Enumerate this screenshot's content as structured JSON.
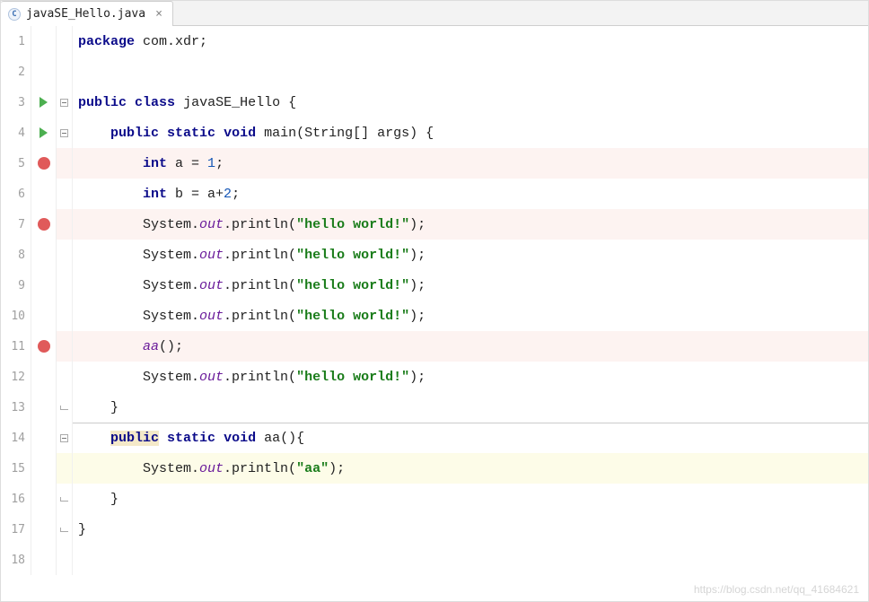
{
  "tab": {
    "filename": "javaSE_Hello.java",
    "close_glyph": "×",
    "icon_letter": "C"
  },
  "lines": [
    {
      "n": 1,
      "icon": "",
      "fold": "",
      "bp": false,
      "hl": false,
      "sep": false,
      "code": [
        {
          "cls": "kw",
          "t": "package"
        },
        {
          "cls": "pln",
          "t": " "
        },
        {
          "cls": "pkg",
          "t": "com.xdr"
        },
        {
          "cls": "pln",
          "t": ";"
        }
      ]
    },
    {
      "n": 2,
      "icon": "",
      "fold": "",
      "bp": false,
      "hl": false,
      "sep": false,
      "code": [
        {
          "cls": "pln",
          "t": ""
        }
      ]
    },
    {
      "n": 3,
      "icon": "run",
      "fold": "open",
      "bp": false,
      "hl": false,
      "sep": false,
      "code": [
        {
          "cls": "kw",
          "t": "public"
        },
        {
          "cls": "pln",
          "t": " "
        },
        {
          "cls": "kw",
          "t": "class"
        },
        {
          "cls": "pln",
          "t": " "
        },
        {
          "cls": "id",
          "t": "javaSE_Hello"
        },
        {
          "cls": "pln",
          "t": " {"
        }
      ]
    },
    {
      "n": 4,
      "icon": "run",
      "fold": "open",
      "bp": false,
      "hl": false,
      "sep": false,
      "code": [
        {
          "cls": "pln",
          "t": "    "
        },
        {
          "cls": "kw",
          "t": "public"
        },
        {
          "cls": "pln",
          "t": " "
        },
        {
          "cls": "kw",
          "t": "static"
        },
        {
          "cls": "pln",
          "t": " "
        },
        {
          "cls": "kw",
          "t": "void"
        },
        {
          "cls": "pln",
          "t": " "
        },
        {
          "cls": "mtd",
          "t": "main"
        },
        {
          "cls": "pln",
          "t": "(String[] args) {"
        }
      ]
    },
    {
      "n": 5,
      "icon": "brk",
      "fold": "",
      "bp": true,
      "hl": false,
      "sep": false,
      "code": [
        {
          "cls": "pln",
          "t": "        "
        },
        {
          "cls": "kw",
          "t": "int"
        },
        {
          "cls": "pln",
          "t": " a = "
        },
        {
          "cls": "num",
          "t": "1"
        },
        {
          "cls": "pln",
          "t": ";"
        }
      ]
    },
    {
      "n": 6,
      "icon": "",
      "fold": "",
      "bp": false,
      "hl": false,
      "sep": false,
      "code": [
        {
          "cls": "pln",
          "t": "        "
        },
        {
          "cls": "kw",
          "t": "int"
        },
        {
          "cls": "pln",
          "t": " b = a+"
        },
        {
          "cls": "num",
          "t": "2"
        },
        {
          "cls": "pln",
          "t": ";"
        }
      ]
    },
    {
      "n": 7,
      "icon": "brk",
      "fold": "",
      "bp": true,
      "hl": false,
      "sep": false,
      "code": [
        {
          "cls": "pln",
          "t": "        System."
        },
        {
          "cls": "fld",
          "t": "out"
        },
        {
          "cls": "pln",
          "t": ".println("
        },
        {
          "cls": "str",
          "t": "\"hello world!\""
        },
        {
          "cls": "pln",
          "t": ");"
        }
      ]
    },
    {
      "n": 8,
      "icon": "",
      "fold": "",
      "bp": false,
      "hl": false,
      "sep": false,
      "code": [
        {
          "cls": "pln",
          "t": "        System."
        },
        {
          "cls": "fld",
          "t": "out"
        },
        {
          "cls": "pln",
          "t": ".println("
        },
        {
          "cls": "str",
          "t": "\"hello world!\""
        },
        {
          "cls": "pln",
          "t": ");"
        }
      ]
    },
    {
      "n": 9,
      "icon": "",
      "fold": "",
      "bp": false,
      "hl": false,
      "sep": false,
      "code": [
        {
          "cls": "pln",
          "t": "        System."
        },
        {
          "cls": "fld",
          "t": "out"
        },
        {
          "cls": "pln",
          "t": ".println("
        },
        {
          "cls": "str",
          "t": "\"hello world!\""
        },
        {
          "cls": "pln",
          "t": ");"
        }
      ]
    },
    {
      "n": 10,
      "icon": "",
      "fold": "",
      "bp": false,
      "hl": false,
      "sep": false,
      "code": [
        {
          "cls": "pln",
          "t": "        System."
        },
        {
          "cls": "fld",
          "t": "out"
        },
        {
          "cls": "pln",
          "t": ".println("
        },
        {
          "cls": "str",
          "t": "\"hello world!\""
        },
        {
          "cls": "pln",
          "t": ");"
        }
      ]
    },
    {
      "n": 11,
      "icon": "brk",
      "fold": "",
      "bp": true,
      "hl": false,
      "sep": false,
      "code": [
        {
          "cls": "pln",
          "t": "        "
        },
        {
          "cls": "fld",
          "t": "aa"
        },
        {
          "cls": "pln",
          "t": "();"
        }
      ]
    },
    {
      "n": 12,
      "icon": "",
      "fold": "",
      "bp": false,
      "hl": false,
      "sep": false,
      "code": [
        {
          "cls": "pln",
          "t": "        System."
        },
        {
          "cls": "fld",
          "t": "out"
        },
        {
          "cls": "pln",
          "t": ".println("
        },
        {
          "cls": "str",
          "t": "\"hello world!\""
        },
        {
          "cls": "pln",
          "t": ");"
        }
      ]
    },
    {
      "n": 13,
      "icon": "",
      "fold": "end",
      "bp": false,
      "hl": false,
      "sep": false,
      "code": [
        {
          "cls": "pln",
          "t": "    }"
        }
      ]
    },
    {
      "n": 14,
      "icon": "",
      "fold": "open",
      "bp": false,
      "hl": false,
      "sep": true,
      "code": [
        {
          "cls": "pln",
          "t": "    "
        },
        {
          "cls": "kw hl-keyword-box",
          "t": "public"
        },
        {
          "cls": "pln",
          "t": " "
        },
        {
          "cls": "kw",
          "t": "static"
        },
        {
          "cls": "pln",
          "t": " "
        },
        {
          "cls": "kw",
          "t": "void"
        },
        {
          "cls": "pln",
          "t": " "
        },
        {
          "cls": "mtd",
          "t": "aa"
        },
        {
          "cls": "pln",
          "t": "(){"
        }
      ]
    },
    {
      "n": 15,
      "icon": "",
      "fold": "",
      "bp": false,
      "hl": true,
      "sep": false,
      "code": [
        {
          "cls": "pln",
          "t": "        System."
        },
        {
          "cls": "fld",
          "t": "out"
        },
        {
          "cls": "pln",
          "t": ".println("
        },
        {
          "cls": "str",
          "t": "\"aa\""
        },
        {
          "cls": "pln",
          "t": ");"
        }
      ]
    },
    {
      "n": 16,
      "icon": "",
      "fold": "end",
      "bp": false,
      "hl": false,
      "sep": false,
      "code": [
        {
          "cls": "pln",
          "t": "    }"
        }
      ]
    },
    {
      "n": 17,
      "icon": "",
      "fold": "end",
      "bp": false,
      "hl": false,
      "sep": false,
      "code": [
        {
          "cls": "pln",
          "t": "}"
        }
      ]
    },
    {
      "n": 18,
      "icon": "",
      "fold": "",
      "bp": false,
      "hl": false,
      "sep": false,
      "code": [
        {
          "cls": "pln",
          "t": ""
        }
      ]
    }
  ],
  "watermark": "https://blog.csdn.net/qq_41684621"
}
